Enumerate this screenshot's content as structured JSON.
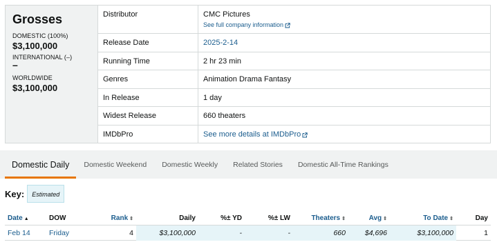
{
  "grosses": {
    "title": "Grosses",
    "domestic_label": "DOMESTIC (100%)",
    "domestic_value": "$3,100,000",
    "international_label": "INTERNATIONAL (–)",
    "international_value": "–",
    "worldwide_label": "WORLDWIDE",
    "worldwide_value": "$3,100,000"
  },
  "details": [
    {
      "key": "Distributor",
      "value": "CMC Pictures",
      "sublink": "See full company information"
    },
    {
      "key": "Release Date",
      "value": "2025-2-14",
      "link": true
    },
    {
      "key": "Running Time",
      "value": "2 hr 23 min"
    },
    {
      "key": "Genres",
      "value": "Animation Drama Fantasy"
    },
    {
      "key": "In Release",
      "value": "1 day"
    },
    {
      "key": "Widest Release",
      "value": "660 theaters"
    },
    {
      "key": "IMDbPro",
      "value": "See more details at IMDbPro",
      "link": true
    }
  ],
  "tabs": [
    "Domestic Daily",
    "Domestic Weekend",
    "Domestic Weekly",
    "Related Stories",
    "Domestic All-Time Rankings"
  ],
  "key": {
    "label": "Key:",
    "badge": "Estimated"
  },
  "table": {
    "headers": {
      "date": "Date",
      "dow": "DOW",
      "rank": "Rank",
      "daily": "Daily",
      "pyd": "%± YD",
      "plw": "%± LW",
      "theaters": "Theaters",
      "avg": "Avg",
      "todate": "To Date",
      "day": "Day"
    },
    "rows": [
      {
        "date": "Feb 14",
        "dow": "Friday",
        "rank": "4",
        "daily": "$3,100,000",
        "pyd": "-",
        "plw": "-",
        "theaters": "660",
        "avg": "$4,696",
        "todate": "$3,100,000",
        "day": "1"
      }
    ]
  },
  "colors": {
    "link": "#1a5c8d",
    "active_tab_underline": "#e77600",
    "panel_bg": "#f0f2f2",
    "estimated_bg": "#e6f4f8"
  }
}
